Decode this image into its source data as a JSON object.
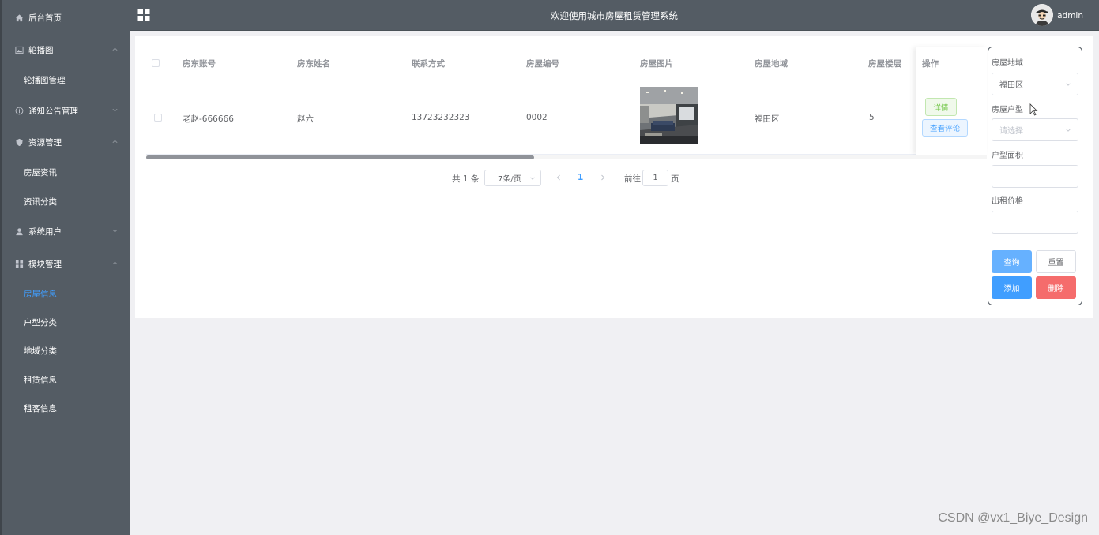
{
  "sidebar": {
    "items": [
      {
        "label": "后台首页",
        "icon": "home-icon"
      },
      {
        "label": "轮播图",
        "icon": "image-icon",
        "expanded": true
      },
      {
        "label": "轮播图管理"
      },
      {
        "label": "通知公告管理",
        "icon": "info-icon",
        "expanded": false
      },
      {
        "label": "资源管理",
        "icon": "shield-icon",
        "expanded": true
      },
      {
        "label": "房屋资讯"
      },
      {
        "label": "资讯分类"
      },
      {
        "label": "系统用户",
        "icon": "user-icon",
        "expanded": false
      },
      {
        "label": "模块管理",
        "icon": "grid-icon",
        "expanded": true
      },
      {
        "label": "房屋信息",
        "active": true
      },
      {
        "label": "户型分类"
      },
      {
        "label": "地域分类"
      },
      {
        "label": "租赁信息"
      },
      {
        "label": "租客信息"
      }
    ],
    "active_color": "#409eff"
  },
  "header": {
    "title": "欢迎使用城市房屋租赁管理系统",
    "username": "admin"
  },
  "table": {
    "columns": [
      "房东账号",
      "房东姓名",
      "联系方式",
      "房屋编号",
      "房屋图片",
      "房屋地域",
      "房屋楼层",
      "操作"
    ],
    "rows": [
      {
        "landlord_account": "老赵-666666",
        "landlord_name": "赵六",
        "phone": "13723232323",
        "house_no": "0002",
        "region": "福田区",
        "floor": "5"
      }
    ],
    "actions": {
      "detail": "详情",
      "comments": "查看评论"
    }
  },
  "pagination": {
    "total": "共 1 条",
    "page_size": "7条/页",
    "current": "1",
    "goto_label": "前往",
    "goto_value": "1",
    "page_label": "页"
  },
  "search_panel": {
    "region_label": "房屋地域",
    "region_value": "福田区",
    "type_label": "房屋户型",
    "type_placeholder": "请选择",
    "area_label": "户型面积",
    "area_value": "",
    "price_label": "出租价格",
    "price_value": "",
    "query": "查询",
    "reset": "重置",
    "add": "添加",
    "delete": "删除"
  },
  "watermark": "CSDN @vx1_Biye_Design"
}
